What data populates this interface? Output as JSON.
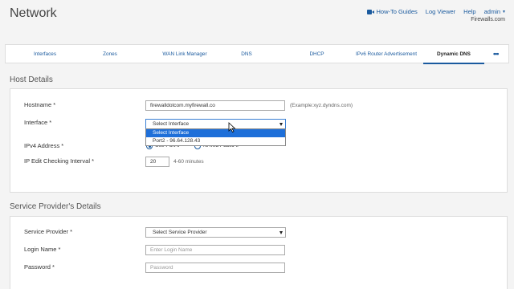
{
  "header": {
    "title": "Network",
    "links": {
      "howto": "How-To Guides",
      "log": "Log Viewer",
      "help": "Help",
      "user": "admin"
    },
    "domain": "Firewalls.com"
  },
  "tabs": [
    {
      "label": "Interfaces",
      "active": false
    },
    {
      "label": "Zones",
      "active": false
    },
    {
      "label": "WAN Link Manager",
      "active": false
    },
    {
      "label": "DNS",
      "active": false
    },
    {
      "label": "DHCP",
      "active": false
    },
    {
      "label": "IPv6 Router Advertisement",
      "active": false
    },
    {
      "label": "Dynamic DNS",
      "active": true
    }
  ],
  "more_label": "•••",
  "host": {
    "section_title": "Host Details",
    "hostname_label": "Hostname *",
    "hostname_value": "firewalldotcom.myfirewall.co",
    "hostname_hint": "(Example:xyz.dyndns.com)",
    "interface_label": "Interface *",
    "interface_value": "Select Interface",
    "interface_options": [
      "Select Interface",
      "Port2 - 96.64.128.43"
    ],
    "ipv4_label": "IPv4 Address *",
    "ipv4_options": [
      "Use Port IP",
      "NATed Public IP"
    ],
    "ipcheck_label": "IP Edit Checking Interval *",
    "ipcheck_value": "20",
    "ipcheck_hint": "4-60 minutes"
  },
  "provider": {
    "section_title": "Service Provider's Details",
    "service_label": "Service Provider *",
    "service_value": "Select Service Provider",
    "login_label": "Login Name *",
    "login_placeholder": "Enter Login Name",
    "password_label": "Password *",
    "password_placeholder": "Password"
  },
  "colors": {
    "accent": "#1a5a9e",
    "selected": "#1e6fd9"
  }
}
